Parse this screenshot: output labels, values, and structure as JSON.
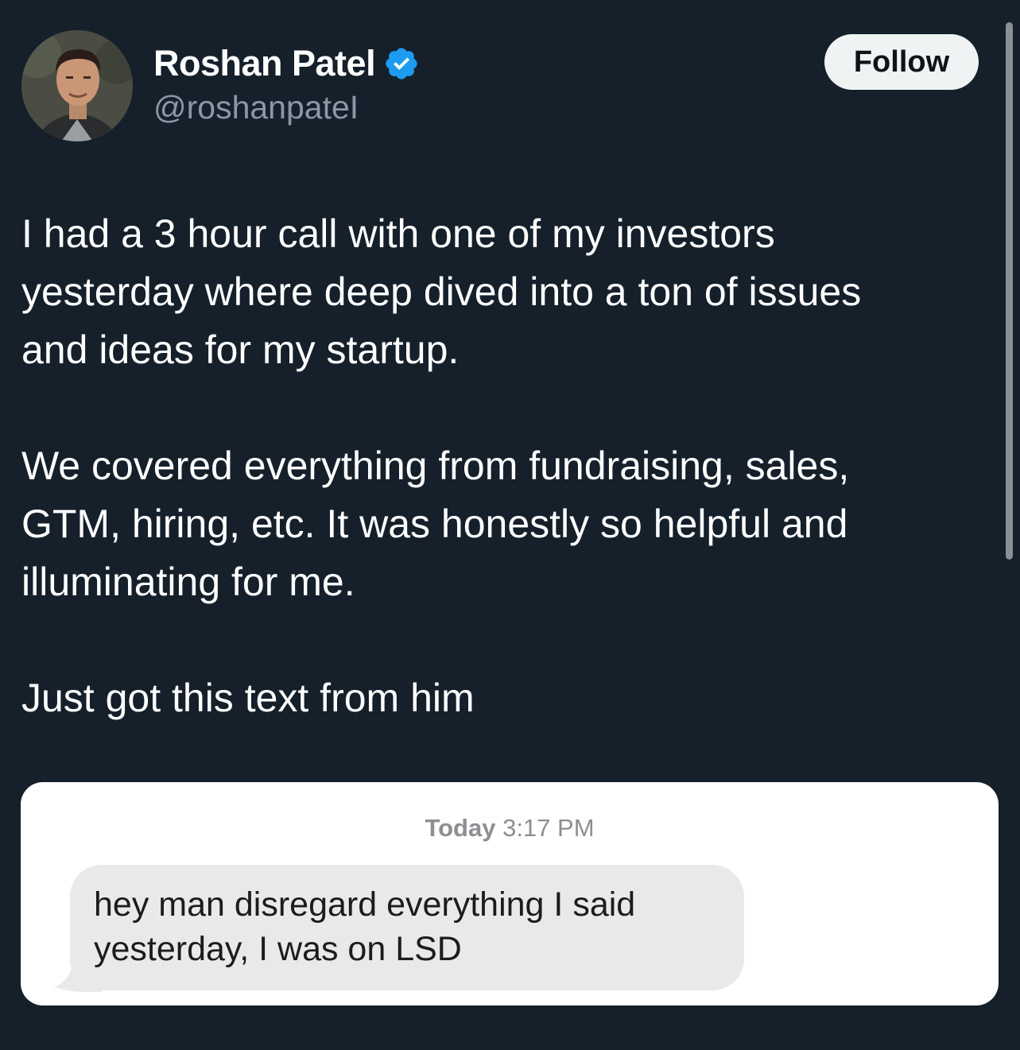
{
  "author": {
    "name": "Roshan Patel",
    "handle": "@roshanpateI",
    "verified": true,
    "verified_icon": "verified-badge-icon",
    "badge_color": "#1d9bf0"
  },
  "follow_button": {
    "label": "Follow"
  },
  "tweet": {
    "paragraphs": [
      "I had a 3 hour call with one of my investors\nyesterday where deep dived into a ton of issues\nand ideas for my startup.",
      "We covered everything from fundraising, sales,\nGTM, hiring, etc. It was honestly so helpful and\nilluminating for me.",
      "Just got this text from him"
    ]
  },
  "media": {
    "timestamp_day": "Today",
    "timestamp_time": "3:17 PM",
    "message": "hey man disregard everything I said\nyesterday, I was on LSD"
  },
  "colors": {
    "background": "#15202b",
    "text": "#ffffff",
    "secondary_text": "#8b98a5",
    "follow_bg": "#eff3f4",
    "bubble_bg": "#e9e9eb"
  }
}
